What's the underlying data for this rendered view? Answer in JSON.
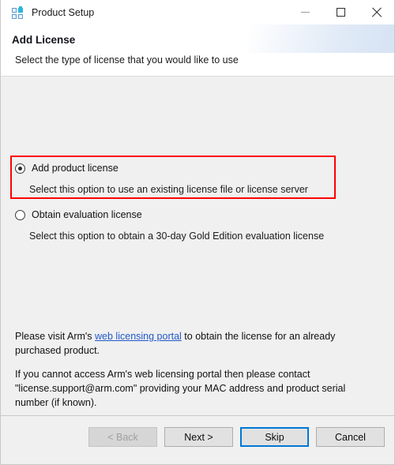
{
  "window": {
    "title": "Product Setup",
    "app_icon": "grid-squares-icon",
    "controls": {
      "minimize": "minimize-icon",
      "maximize": "maximize-icon",
      "close": "close-icon"
    }
  },
  "header": {
    "title": "Add License",
    "subtitle": "Select the type of license that you would like to use"
  },
  "options": {
    "add_license": {
      "label": "Add product license",
      "description": "Select this option to use an existing license file or license server",
      "selected": true,
      "highlighted": true
    },
    "evaluation_license": {
      "label": "Obtain evaluation license",
      "description": "Select this option to obtain a 30-day Gold Edition evaluation license",
      "selected": false,
      "highlighted": false
    }
  },
  "info": {
    "paragraph_1_before_link": "Please visit Arm's ",
    "link_text": "web licensing portal",
    "paragraph_1_after_link": " to obtain the license for an already purchased product.",
    "paragraph_2": "If you cannot access Arm's web licensing portal then please contact \"license.support@arm.com\" providing your MAC address and product serial number (if known)."
  },
  "footer": {
    "back_label": "< Back",
    "next_label": "Next >",
    "skip_label": "Skip",
    "cancel_label": "Cancel"
  },
  "colors": {
    "highlight_red": "#ff0000",
    "link_blue": "#2158c9",
    "focus_blue": "#0078d7",
    "body_background": "#f0f0f0",
    "titlebar_background": "#ffffff",
    "accent_cyan": "#2bb6d9"
  }
}
